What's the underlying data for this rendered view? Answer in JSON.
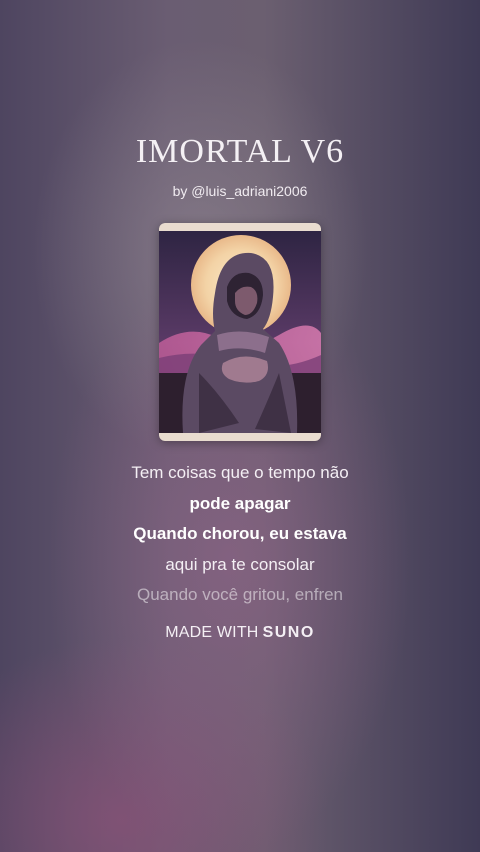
{
  "song": {
    "title": "IMORTAL V6",
    "byline": "by @luis_adriani2006"
  },
  "cover": {
    "icon": "hooded-figure-moon-artwork"
  },
  "lyrics": [
    {
      "text": "Tem coisas que o tempo não",
      "style": "normal"
    },
    {
      "text": "pode apagar",
      "style": "bold"
    },
    {
      "text": "Quando chorou, eu estava",
      "style": "bold"
    },
    {
      "text": "aqui pra te consolar",
      "style": "normal"
    },
    {
      "text": "Quando você gritou, enfren",
      "style": "faded"
    }
  ],
  "footer": {
    "prefix": "MADE WITH",
    "brand": "SUNO"
  }
}
